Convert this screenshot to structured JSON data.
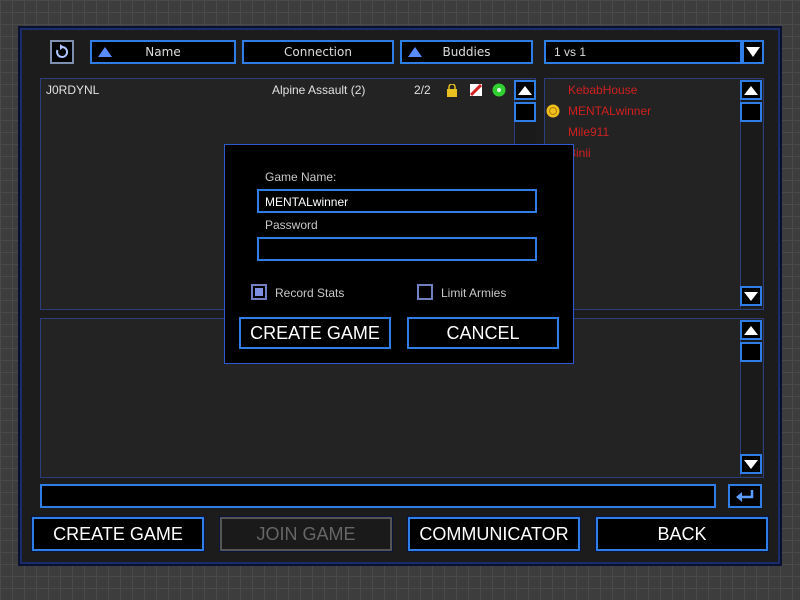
{
  "lobby": {
    "columns": {
      "name": "Name",
      "connection": "Connection",
      "buddies": "Buddies"
    },
    "mode_select": {
      "value": "1 vs 1"
    },
    "games": [
      {
        "host": "J0RDYNL",
        "map": "Alpine Assault (2)",
        "players": "2/2",
        "icons": [
          "lock-icon",
          "stats-icon",
          "connection-good-icon"
        ]
      }
    ],
    "players": [
      {
        "name": "KebabHouse",
        "icon": ""
      },
      {
        "name": "MENTALwinner",
        "icon": "rank-medal-icon"
      },
      {
        "name": "Mile911",
        "icon": ""
      },
      {
        "name": "Binii",
        "icon": ""
      }
    ],
    "chat_input": {
      "value": ""
    }
  },
  "buttons": {
    "create_game": "CREATE GAME",
    "join_game": "JOIN GAME",
    "communicator": "COMMUNICATOR",
    "back": "BACK"
  },
  "dialog": {
    "game_name_label": "Game Name:",
    "game_name_value": "MENTALwinner",
    "password_label": "Password",
    "password_value": "",
    "record_stats_label": "Record Stats",
    "record_stats_checked": true,
    "limit_armies_label": "Limit Armies",
    "limit_armies_checked": false,
    "create_button": "CREATE GAME",
    "cancel_button": "CANCEL"
  },
  "colors": {
    "accent": "#2f7de6",
    "player_name": "#d02020",
    "status_green": "#30d030",
    "lock_yellow": "#e8c020"
  }
}
